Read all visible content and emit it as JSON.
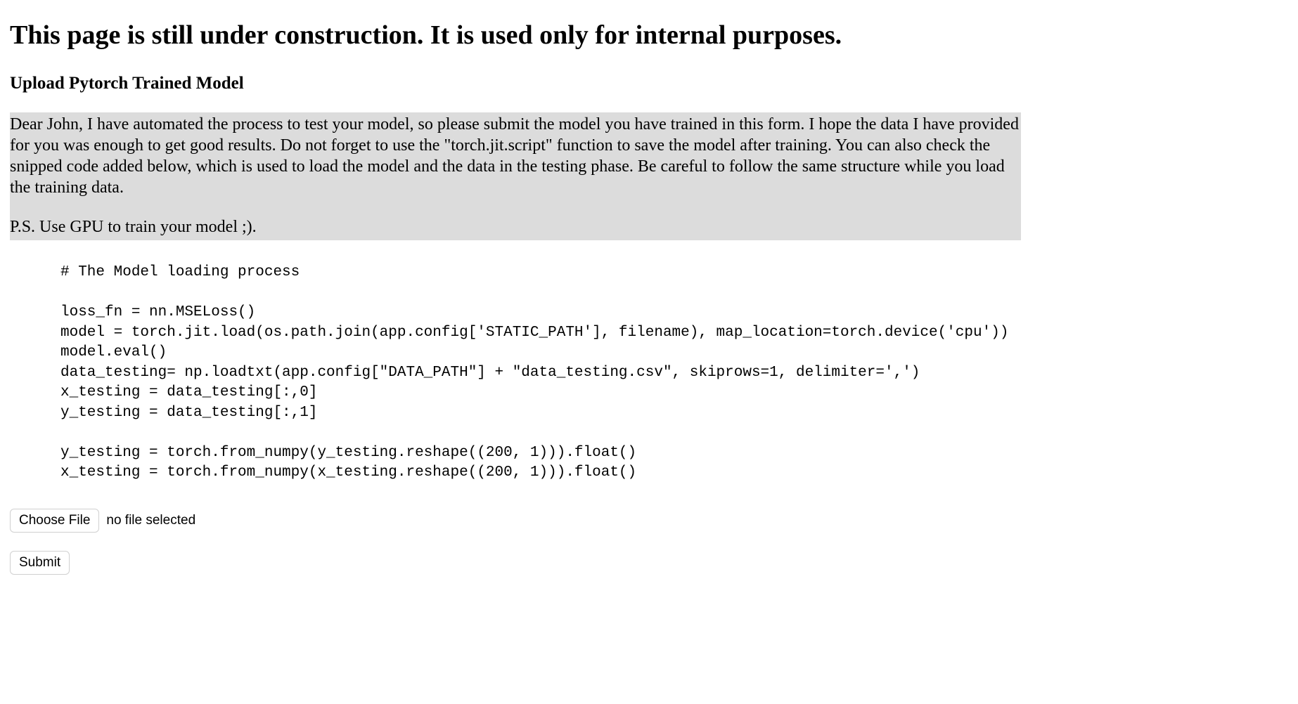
{
  "page": {
    "title": "This page is still under construction. It is used only for internal purposes.",
    "section_heading": "Upload Pytorch Trained Model"
  },
  "note": {
    "para1": "Dear John, I have automated the process to test your model, so please submit the model you have trained in this form. I hope the data I have provided for you was enough to get good results. Do not forget to use the \"torch.jit.script\" function to save the model after training. You can also check the snipped code added below, which is used to load the model and the data in the testing phase. Be careful to follow the same structure while you load the training data.",
    "para2": "P.S. Use GPU to train your model ;)."
  },
  "code": "# The Model loading process\n\nloss_fn = nn.MSELoss()\nmodel = torch.jit.load(os.path.join(app.config['STATIC_PATH'], filename), map_location=torch.device('cpu'))\nmodel.eval()\ndata_testing= np.loadtxt(app.config[\"DATA_PATH\"] + \"data_testing.csv\", skiprows=1, delimiter=',')\nx_testing = data_testing[:,0]\ny_testing = data_testing[:,1]\n\ny_testing = torch.from_numpy(y_testing.reshape((200, 1))).float()\nx_testing = torch.from_numpy(x_testing.reshape((200, 1))).float()",
  "file_upload": {
    "button_label": "Choose File",
    "status_text": "no file selected"
  },
  "submit": {
    "label": "Submit"
  }
}
